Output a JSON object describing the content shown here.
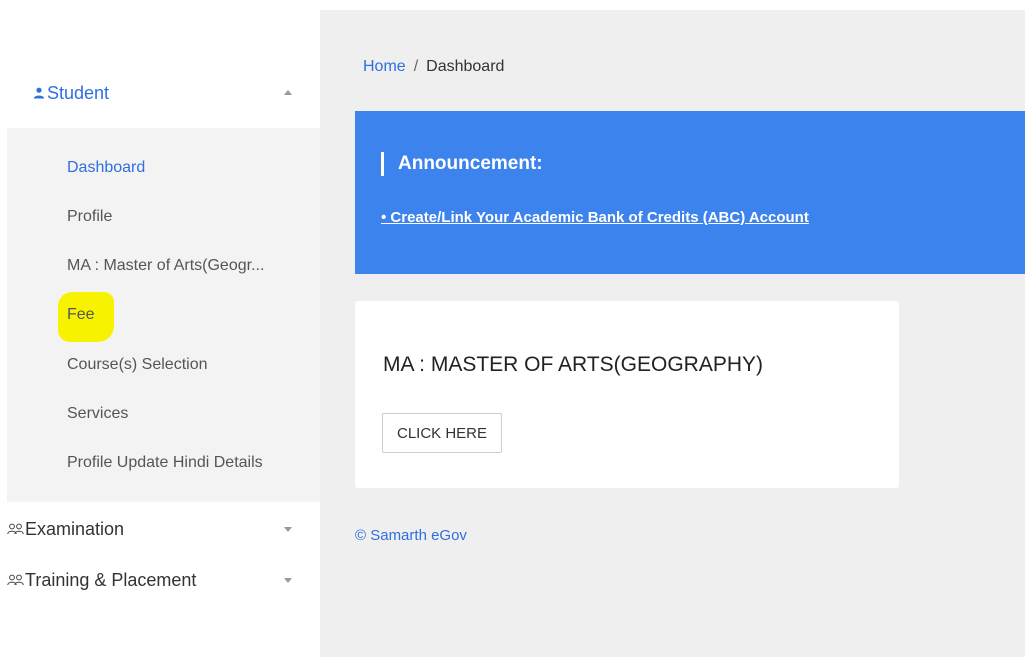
{
  "sidebar": {
    "student": {
      "label": "Student",
      "icon": "person-icon",
      "expanded": true
    },
    "student_items": [
      {
        "label": "Dashboard",
        "active": true
      },
      {
        "label": "Profile"
      },
      {
        "label": "MA : Master of Arts(Geogr..."
      },
      {
        "label": "Fee",
        "highlighted": true
      },
      {
        "label": "Course(s) Selection"
      },
      {
        "label": "Services"
      },
      {
        "label": "Profile Update Hindi Details"
      }
    ],
    "examination": {
      "label": "Examination",
      "icon": "people-icon",
      "expanded": false
    },
    "training": {
      "label": "Training & Placement",
      "icon": "people-icon",
      "expanded": false
    }
  },
  "breadcrumb": {
    "home": "Home",
    "separator": "/",
    "current": "Dashboard"
  },
  "announcement": {
    "title": "Announcement:",
    "link": "• Create/Link Your Academic Bank of Credits (ABC) Account"
  },
  "program_card": {
    "title": "MA : MASTER OF ARTS(GEOGRAPHY)",
    "button_label": "CLICK HERE"
  },
  "footer": {
    "text": "© Samarth eGov"
  },
  "colors": {
    "accent": "#2f6fe0",
    "announcement_bg": "#3d83ee",
    "main_bg": "#efefef",
    "highlight": "#f6f200"
  }
}
